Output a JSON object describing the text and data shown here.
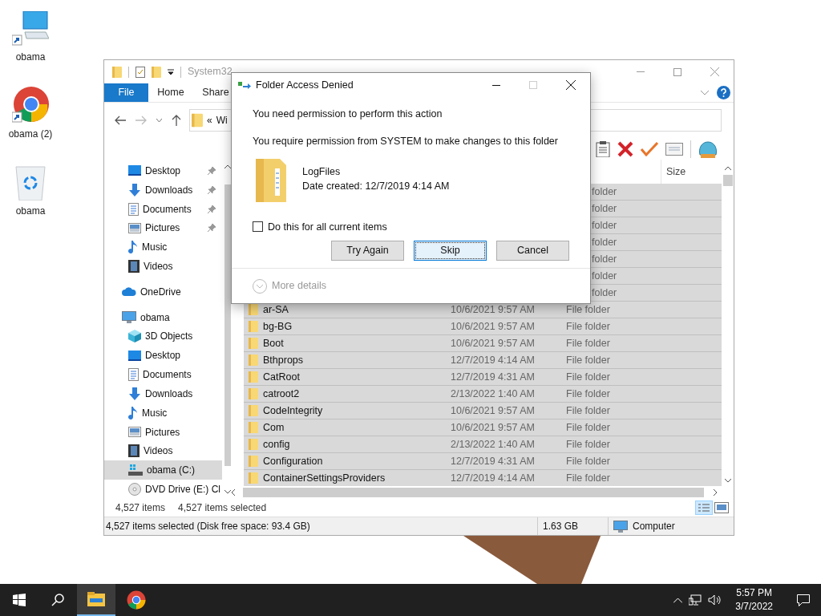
{
  "desktop_icons": [
    {
      "kind": "computer",
      "label": "obama"
    },
    {
      "kind": "chrome",
      "label": "obama (2)"
    },
    {
      "kind": "recycle",
      "label": "obama"
    }
  ],
  "explorer": {
    "title": "System32",
    "ribbon_tabs": [
      {
        "label": "File",
        "selected": true
      },
      {
        "label": "Home",
        "selected": false
      },
      {
        "label": "Share",
        "selected": false
      }
    ],
    "address": {
      "prefix": "«",
      "path": "Wi"
    },
    "nav": {
      "quick_access": [
        {
          "kind": "desktop",
          "label": "Desktop",
          "pinned": true,
          "selected": false
        },
        {
          "kind": "downloads",
          "label": "Downloads",
          "pinned": true,
          "selected": false
        },
        {
          "kind": "documents",
          "label": "Documents",
          "pinned": true,
          "selected": false
        },
        {
          "kind": "pictures",
          "label": "Pictures",
          "pinned": true,
          "selected": false
        },
        {
          "kind": "music",
          "label": "Music",
          "pinned": false,
          "selected": false
        },
        {
          "kind": "videos",
          "label": "Videos",
          "pinned": false,
          "selected": false
        }
      ],
      "onedrive": {
        "kind": "cloud",
        "label": "OneDrive",
        "selected": false
      },
      "this_pc": {
        "kind": "computer",
        "label": "obama",
        "selected": false,
        "children": [
          {
            "kind": "cube",
            "label": "3D Objects",
            "selected": false
          },
          {
            "kind": "desktop",
            "label": "Desktop",
            "selected": false
          },
          {
            "kind": "documents",
            "label": "Documents",
            "selected": false
          },
          {
            "kind": "downloads",
            "label": "Downloads",
            "selected": false
          },
          {
            "kind": "music",
            "label": "Music",
            "selected": false
          },
          {
            "kind": "pictures",
            "label": "Pictures",
            "selected": false
          },
          {
            "kind": "videos",
            "label": "Videos",
            "selected": false
          },
          {
            "kind": "drive",
            "label": "obama (C:)",
            "selected": true
          },
          {
            "kind": "dvd",
            "label": "DVD Drive (E:) Cl",
            "selected": false
          }
        ]
      }
    },
    "columns": [
      {
        "label": "Size"
      }
    ],
    "rows": [
      {
        "type": "folder",
        "selected": true
      },
      {
        "type": "folder",
        "selected": true
      },
      {
        "type": "folder",
        "selected": true
      },
      {
        "type": "folder",
        "selected": true
      },
      {
        "type": "folder",
        "selected": true
      },
      {
        "type": "folder",
        "selected": true
      },
      {
        "type": "folder",
        "selected": true
      },
      {
        "name": "ar-SA",
        "date": "10/6/2021 9:57 AM",
        "type": "File folder",
        "selected": true
      },
      {
        "name": "bg-BG",
        "date": "10/6/2021 9:57 AM",
        "type": "File folder",
        "selected": true
      },
      {
        "name": "Boot",
        "date": "10/6/2021 9:57 AM",
        "type": "File folder",
        "selected": true
      },
      {
        "name": "Bthprops",
        "date": "12/7/2019 4:14 AM",
        "type": "File folder",
        "selected": true
      },
      {
        "name": "CatRoot",
        "date": "12/7/2019 4:31 AM",
        "type": "File folder",
        "selected": true
      },
      {
        "name": "catroot2",
        "date": "2/13/2022 1:40 AM",
        "type": "File folder",
        "selected": true
      },
      {
        "name": "CodeIntegrity",
        "date": "10/6/2021 9:57 AM",
        "type": "File folder",
        "selected": true
      },
      {
        "name": "Com",
        "date": "10/6/2021 9:57 AM",
        "type": "File folder",
        "selected": true
      },
      {
        "name": "config",
        "date": "2/13/2022 1:40 AM",
        "type": "File folder",
        "selected": true
      },
      {
        "name": "Configuration",
        "date": "12/7/2019 4:31 AM",
        "type": "File folder",
        "selected": true
      },
      {
        "name": "ContainerSettingsProviders",
        "date": "12/7/2019 4:14 AM",
        "type": "File folder",
        "selected": true
      }
    ],
    "item_count": "4,527 items",
    "selected_count": "4,527 items selected",
    "status_bar": {
      "selection": "4,527 items selected (Disk free space: 93.4 GB)",
      "size": "1.63 GB",
      "location": "Computer"
    }
  },
  "dialog": {
    "title": "Folder Access Denied",
    "message": "You need permission to perform this action",
    "detail": "You require permission from SYSTEM to make changes to this folder",
    "item": {
      "name": "LogFiles",
      "created": "Date created: 12/7/2019 4:14 AM"
    },
    "checkbox": {
      "label": "Do this for all current items",
      "checked": false
    },
    "buttons": [
      {
        "label": "Try Again",
        "selected": false
      },
      {
        "label": "Skip",
        "selected": true
      },
      {
        "label": "Cancel",
        "selected": false
      }
    ],
    "more_details": "More details"
  },
  "taskbar": {
    "apps": [
      {
        "kind": "explorer",
        "selected": true
      },
      {
        "kind": "chrome",
        "selected": false
      }
    ],
    "time": "5:57 PM",
    "date": "3/7/2022"
  }
}
